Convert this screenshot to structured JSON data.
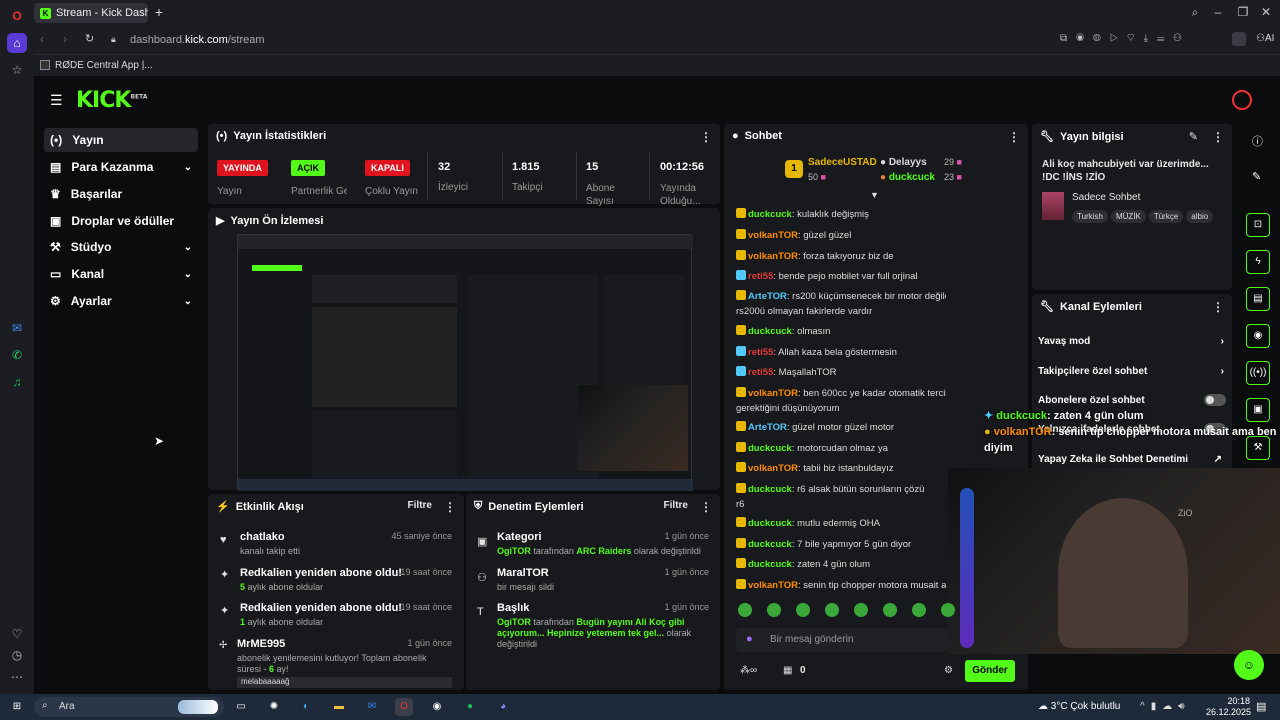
{
  "browser": {
    "tab_title": "Stream - Kick Dashboard",
    "url_prefix": "dashboard.",
    "url_domain": "kick.com",
    "url_path": "/stream",
    "bookmark": "RØDE Central App |...",
    "ai_label": "AI"
  },
  "logo": {
    "text": "KICK",
    "beta": "BETA"
  },
  "nav": {
    "items": [
      {
        "label": "Yayın",
        "icon": "broadcast-icon"
      },
      {
        "label": "Para Kazanma",
        "icon": "money-icon"
      },
      {
        "label": "Başarılar",
        "icon": "trophy-icon"
      },
      {
        "label": "Droplar ve ödüller",
        "icon": "gift-icon"
      },
      {
        "label": "Stüdyo",
        "icon": "studio-icon"
      },
      {
        "label": "Kanal",
        "icon": "channel-icon"
      },
      {
        "label": "Ayarlar",
        "icon": "gear-icon"
      }
    ]
  },
  "stats": {
    "title": "Yayın İstatistikleri",
    "live_badge": "YAYINDA",
    "live_label": "Yayın",
    "partner_badge": "AÇIK",
    "partner_label": "Partnerlik Gelir...",
    "multi_badge": "KAPALI",
    "multi_label": "Çoklu Yayın",
    "viewers_val": "32",
    "viewers_label": "İzleyici",
    "followers_val": "1.815",
    "followers_label": "Takipçi",
    "subs_val": "15",
    "subs_label": "Abone Sayısı",
    "uptime_val": "00:12:56",
    "uptime_label": "Yayında Olduğu..."
  },
  "preview": {
    "title": "Yayın Ön İzlemesi"
  },
  "activity": {
    "title": "Etkinlik Akışı",
    "filter": "Filtre",
    "items": [
      {
        "title": "chatlako",
        "sub": "kanalı takip etti",
        "time": "45 saniye önce"
      },
      {
        "title": "Redkalien yeniden abone oldu!",
        "sub_num": "5",
        "sub": " aylık abone oldular",
        "time": "19 saat önce"
      },
      {
        "title": "Redkalien yeniden abone oldu!",
        "sub_num": "1",
        "sub": " aylık abone oldular",
        "time": "19 saat önce"
      },
      {
        "title": "MrME995",
        "sub": "abonelik yenilemesini kutluyor! Toplam abonelik süresi -",
        "sub_num": "6",
        "sub2": " ay!",
        "time": "1 gün önce"
      }
    ],
    "input_text": "melabaaaaağ"
  },
  "moderation": {
    "title": "Denetim Eylemleri",
    "filter": "Filtre",
    "items": [
      {
        "title": "Kategori",
        "time": "1 gün önce",
        "actor": "OgiTOR",
        "mid": " tarafından ",
        "highlight": "ARC Raiders",
        "tail": " olarak değiştirildi"
      },
      {
        "title": "MaralTOR",
        "time": "1 gün önce",
        "sub": "bir mesajı sildi"
      },
      {
        "title": "Başlık",
        "time": "1 gün önce",
        "actor": "OgiTOR",
        "mid": " tarafından ",
        "highlight": "Bugün yayını Ali Koç gibi açıyorum... Hepinize yetemem tek gel...",
        "tail": " olarak değiştirildi"
      }
    ]
  },
  "chat": {
    "title": "Sohbet",
    "top1_name": "SadeceUSTAD",
    "top1_count": "50",
    "top2_name": "Delayys",
    "top2_count": "29",
    "top3_name": "duckcuck",
    "top3_count": "23",
    "messages": [
      {
        "user": "duckcuck",
        "cls": "u-g",
        "text": ": kulaklık değişmiş"
      },
      {
        "user": "volkanTOR",
        "cls": "u-o",
        "text": ": güzel güzel"
      },
      {
        "user": "volkanTOR",
        "cls": "u-o",
        "text": ": forza takıyoruz biz de"
      },
      {
        "user": "reti55",
        "cls": "u-r",
        "text": ": bende pejo mobilet var full orjinal"
      },
      {
        "user": "ArteTOR",
        "cls": "u-c",
        "text": ": rs200 küçümsenecek bir motor değildir gayet güzel"
      },
      {
        "user": "",
        "cls": "",
        "text": "rs200ü olmayan fakirlerde vardır"
      },
      {
        "user": "duckcuck",
        "cls": "u-g",
        "text": ": olmasın"
      },
      {
        "user": "reti55",
        "cls": "u-r",
        "text": ": Allah kaza bela göstermesin"
      },
      {
        "user": "reti55",
        "cls": "u-r",
        "text": ": MaşallahTOR"
      },
      {
        "user": "volkanTOR",
        "cls": "u-o",
        "text": ": ben 600cc ye kadar otomatik tercih edilmesi"
      },
      {
        "user": "",
        "cls": "",
        "text": "gerektiğini düşünüyorum"
      },
      {
        "user": "ArteTOR",
        "cls": "u-c",
        "text": ": güzel motor güzel motor"
      },
      {
        "user": "duckcuck",
        "cls": "u-g",
        "text": ": motorcudan olmaz ya"
      },
      {
        "user": "volkanTOR",
        "cls": "u-o",
        "text": ": tabii biz istanbuldayız"
      },
      {
        "user": "duckcuck",
        "cls": "u-g",
        "text": ": r6 alsak bütün sorunların çözü"
      },
      {
        "user": "",
        "cls": "",
        "text": "r6"
      },
      {
        "user": "duckcuck",
        "cls": "u-g",
        "text": ": mutlu edermiş OHA"
      },
      {
        "user": "duckcuck",
        "cls": "u-g",
        "text": ": 7 bile yapmıyor 5 gün diyor"
      },
      {
        "user": "duckcuck",
        "cls": "u-g",
        "text": ": zaten 4 gün olum"
      },
      {
        "user": "volkanTOR",
        "cls": "u-o",
        "text": ": senin tip chopper motora musait am"
      }
    ],
    "placeholder": "Bir mesaj gönderin",
    "count": "0",
    "send": "Gönder"
  },
  "info": {
    "title": "Yayın bilgisi",
    "stream_title": "Ali koç mahcubiyeti var üzerimde... !DC !İNS !ZİO",
    "category": "Sadece Sohbet",
    "tags": [
      "Turkish",
      "MÜZİK",
      "Türkçe",
      "albio"
    ]
  },
  "channel_actions": {
    "title": "Kanal Eylemleri",
    "items": [
      "Yavaş mod",
      "Takipçilere özel sohbet",
      "Abonelere özel sohbet",
      "Yalnızca ifadelerle sohbet",
      "Yapay Zeka ile Sohbet Denetimi"
    ]
  },
  "overlay": {
    "line1_user": "duckcuck",
    "line1_text": ": zaten 4 gün olum",
    "line2_user": "volkanTOR",
    "line2_text": ": senin tip chopper motora musait ama ben",
    "line3_text": "diyim"
  },
  "taskbar": {
    "search": "Ara",
    "weather": "3°C  Çok bulutlu",
    "time": "20:18",
    "date": "26.12.2025"
  },
  "colors": {
    "accent": "#53fc18",
    "live": "#e0141e"
  }
}
